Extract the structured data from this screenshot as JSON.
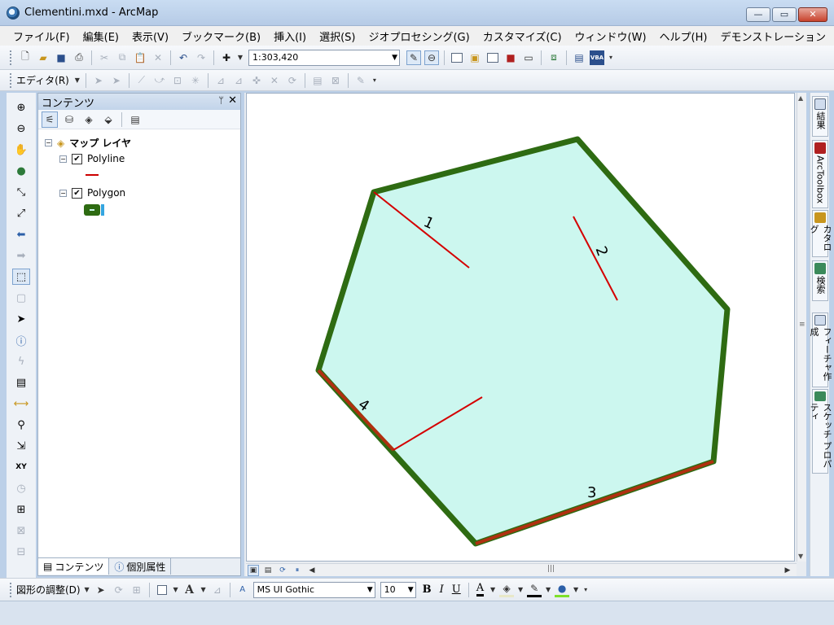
{
  "window": {
    "title": "Clementini.mxd - ArcMap",
    "min": "—",
    "max": "▭",
    "close": "✕"
  },
  "menu": [
    "ファイル(F)",
    "編集(E)",
    "表示(V)",
    "ブックマーク(B)",
    "挿入(I)",
    "選択(S)",
    "ジオプロセシング(G)",
    "カスタマイズ(C)",
    "ウィンドウ(W)",
    "ヘルプ(H)",
    "デモンストレーション"
  ],
  "standard_toolbar": {
    "scale": "1:303,420"
  },
  "editor_toolbar": {
    "label": "エディタ(R)"
  },
  "toc": {
    "title": "コンテンツ",
    "root": "マップ レイヤ",
    "layers": [
      {
        "name": "Polyline",
        "checked": true,
        "symbol_color": "#cc0000"
      },
      {
        "name": "Polygon",
        "checked": true,
        "symbol_color": "#2e6b12"
      }
    ],
    "tabs": [
      "コンテンツ",
      "個別属性"
    ]
  },
  "map": {
    "polygon_fill": "#ccf7ef",
    "polygon_outline": "#2e6b12",
    "shared_edge_color": "#b03010",
    "line_color": "#d40000",
    "labels": [
      "1",
      "2",
      "3",
      "4"
    ]
  },
  "right_dock": [
    "結果",
    "ArcToolbox",
    "カタログ",
    "検索",
    "フィーチャ作成",
    "スケッチ プロパティ"
  ],
  "draw_toolbar": {
    "label": "図形の調整(D)",
    "font": "MS UI Gothic",
    "size": "10",
    "bold": "B",
    "italic": "I",
    "underline": "U",
    "text_color_label": "A"
  }
}
